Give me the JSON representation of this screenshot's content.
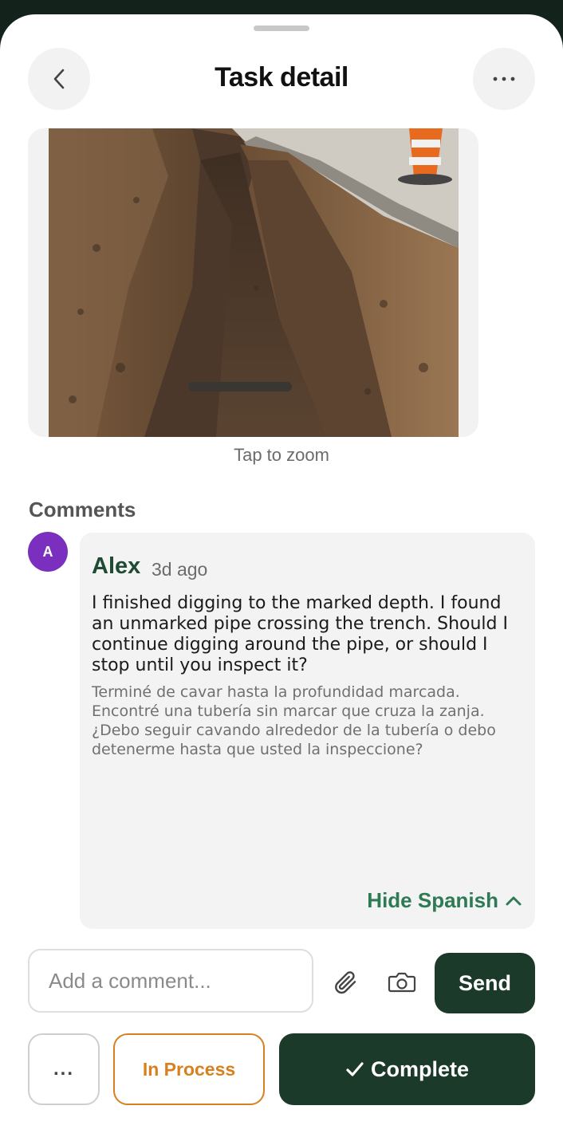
{
  "header": {
    "title": "Task detail",
    "back_icon": "chevron-left-icon",
    "more_icon": "more-horizontal-icon"
  },
  "photo": {
    "description_icon": "trench-photo",
    "zoom_hint": "Tap to zoom"
  },
  "comments": {
    "heading": "Comments",
    "items": [
      {
        "avatar_initial": "A",
        "avatar_color": "#7b2fbf",
        "author": "Alex",
        "time": "3d ago",
        "text_en": "I finished digging to the marked depth. I found an unmarked pipe crossing the trench. Should I continue digging around the pipe, or should I stop until you inspect it?",
        "text_es": "Terminé de cavar hasta la profundidad marcada. Encontré una tubería sin marcar que cruza la zanja. ¿Debo seguir cavando alrededor de la tubería o debo detenerme hasta que usted la inspeccione?",
        "toggle_label": "Hide Spanish"
      }
    ]
  },
  "composer": {
    "placeholder": "Add a comment...",
    "value": "",
    "send_label": "Send",
    "attach_icon": "paperclip-icon",
    "camera_icon": "camera-icon"
  },
  "actions": {
    "more_label": "...",
    "in_process_label": "In Process",
    "complete_label": "Complete",
    "complete_icon": "checkmark-icon"
  },
  "colors": {
    "primary_dark_green": "#1c3a2a",
    "accent_green": "#2e7a55",
    "author_green": "#1f4a33",
    "in_process_orange": "#d9801e"
  }
}
